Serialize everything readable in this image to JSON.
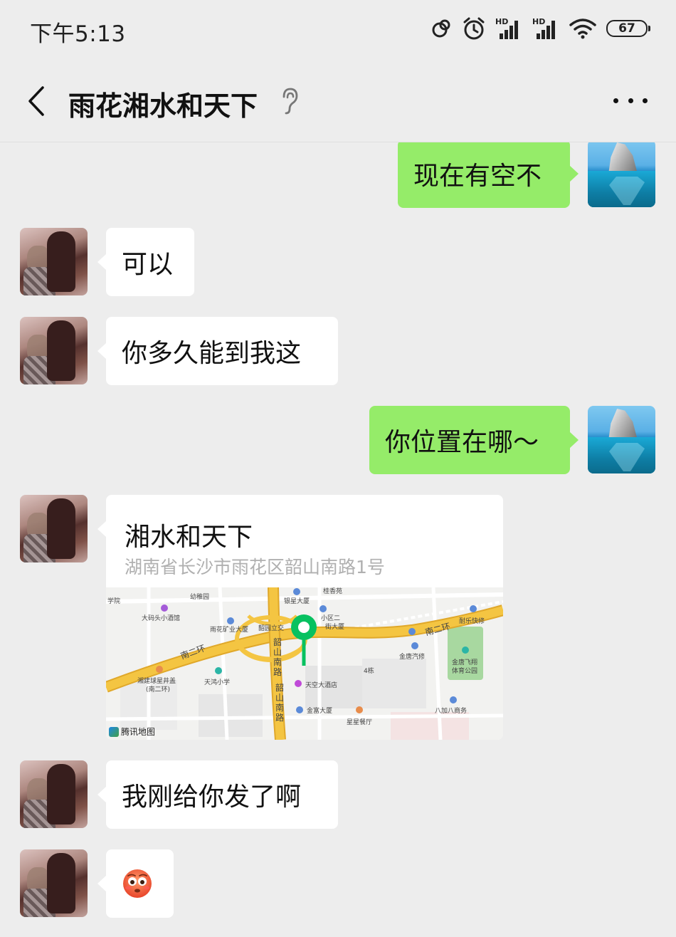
{
  "status_bar": {
    "time": "下午5:13",
    "hd1": "HD",
    "hd2": "HD",
    "battery": "67",
    "icons": [
      "sync-icon",
      "alarm-icon",
      "hd-signal-icon",
      "hd-signal-icon",
      "wifi-icon",
      "battery-icon"
    ]
  },
  "header": {
    "title": "雨花湘水和天下",
    "icons": [
      "back-icon",
      "ear-icon",
      "more-icon"
    ]
  },
  "messages": [
    {
      "from": "me",
      "type": "text",
      "text": "现在有空不"
    },
    {
      "from": "other",
      "type": "text",
      "text": "可以"
    },
    {
      "from": "other",
      "type": "text",
      "text": "你多久能到我这"
    },
    {
      "from": "me",
      "type": "text",
      "text": "你位置在哪～"
    },
    {
      "from": "other",
      "type": "location",
      "name": "湘水和天下",
      "address": "湖南省长沙市雨花区韶山南路1号"
    },
    {
      "from": "other",
      "type": "text",
      "text": "我刚给你发了啊"
    },
    {
      "from": "other",
      "type": "emoji",
      "emoji": "flushed-face-icon"
    }
  ],
  "map": {
    "labels": {
      "school": "学院",
      "kindergarten": "幼稚园",
      "yinxing": "银星大厦",
      "guixiang": "桂香苑",
      "xiaoqu": "小区二",
      "xiaoqu2": "街大厦",
      "damatou": "大码头小酒馆",
      "kuangye": "雨花矿业大厦",
      "interchange": "韶园立交",
      "ring_left": "南二环",
      "ring_right": "南二环",
      "road1": "韶山南路",
      "road2": "韶山南路",
      "xiangjian": "湘建球星井盖",
      "xiangjian2": "(南二环)",
      "tianhong": "天鸿小学",
      "tiankong": "天空大酒店",
      "building4": "4栋",
      "jinfu": "金富大厦",
      "xingxing": "星星餐厅",
      "naile": "耐乐快修",
      "jintang_auto": "金唐汽修",
      "jintang_park1": "金唐飞翔",
      "jintang_park2": "体育公园",
      "babajia": "八加八商务",
      "watermark": "腾讯地图"
    },
    "colors": {
      "road_major": "#f4c542",
      "road_outline": "#e0a82a",
      "land": "#f2f2f0",
      "park": "#a8d8a0",
      "pin": "#07c160"
    }
  },
  "colors": {
    "background": "#ededed",
    "my_bubble": "#95ec69",
    "other_bubble": "#ffffff"
  }
}
